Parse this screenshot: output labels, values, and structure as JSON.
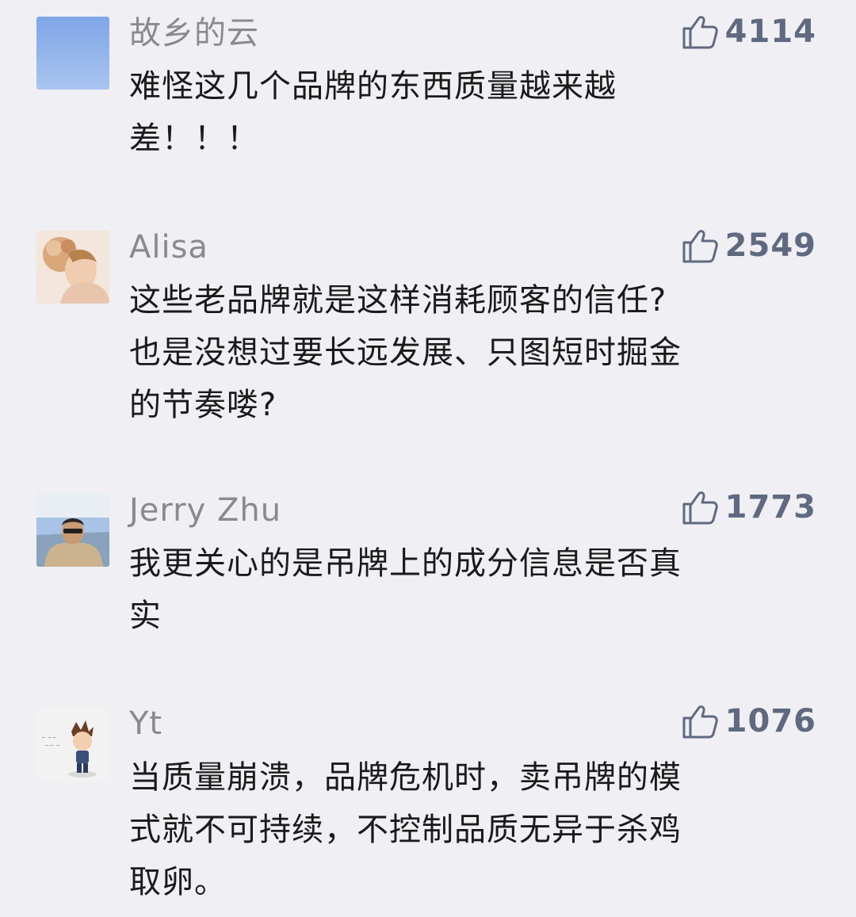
{
  "comments": [
    {
      "user": "故乡的云",
      "likes": "4114",
      "text_lines": [
        "难怪这几个品牌的东西质量越来越",
        "差！！！"
      ],
      "avatar": "blue-sky-avatar"
    },
    {
      "user": "Alisa",
      "likes": "2549",
      "text_lines": [
        "这些老品牌就是这样消耗顾客的信任?",
        "也是没想过要长远发展、只图短时掘金",
        "的节奏喽?"
      ],
      "avatar": "woman-with-flowers-avatar"
    },
    {
      "user": "Jerry Zhu",
      "likes": "1773",
      "text_lines": [
        "我更关心的是吊牌上的成分信息是否真",
        "实"
      ],
      "avatar": "man-with-sunglasses-avatar"
    },
    {
      "user": "Yt",
      "likes": "1076",
      "text_lines": [
        "当质量崩溃，品牌危机时，卖吊牌的模",
        "式就不可持续，不控制品质无异于杀鸡",
        "取卵。"
      ],
      "avatar": "cartoon-boy-avatar"
    }
  ],
  "colors": {
    "background": "#efeff4",
    "username": "#8a8a8e",
    "likes": "#5f6a80",
    "text": "#1a1a1a"
  },
  "icons": {
    "like": "thumbs-up-icon"
  }
}
